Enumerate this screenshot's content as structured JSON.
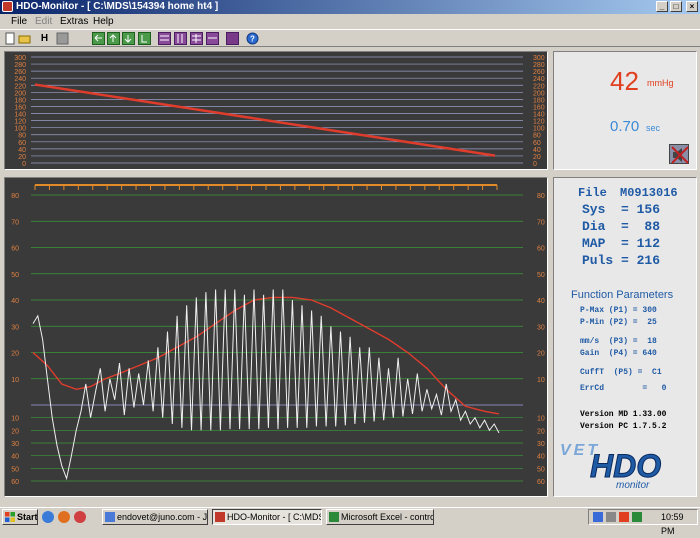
{
  "window": {
    "title": "HDO-Monitor - [ C:\\MDS\\154394 home ht4 ]",
    "controls": [
      "_",
      "□",
      "×"
    ]
  },
  "menu": {
    "file": "File",
    "edit": "Edit",
    "extras": "Extras",
    "help": "Help"
  },
  "toolbar": {
    "h_label": "H"
  },
  "readout": {
    "pressure_value": "42",
    "pressure_unit": "mmHg",
    "time_value": "0.70",
    "time_unit": "sec"
  },
  "info": {
    "file_label": "File",
    "file_value": "M0913016",
    "sys": "Sys  = 156",
    "dia": "Dia  =  88",
    "map": "MAP  = 112",
    "puls": "Puls = 216",
    "func_title": "Function Parameters",
    "params": [
      "P-Max (P1) = 300",
      "P-Min (P2) =  25",
      "mm/s  (P3) =  18",
      "Gain  (P4) = 640",
      "CuffT  (P5) =  C1",
      "ErrCd        =   0"
    ],
    "version_md": "Version MD 1.33.00",
    "version_pc": "Version PC 1.7.5.2",
    "logo_vet": "VET",
    "logo_hdo": "HDO",
    "logo_monitor": "monitor"
  },
  "top_chart": {
    "y_ticks": [
      "300",
      "280",
      "260",
      "240",
      "220",
      "200",
      "180",
      "160",
      "140",
      "120",
      "100",
      "80",
      "60",
      "40",
      "20",
      "0"
    ]
  },
  "main_chart": {
    "y_ticks_pos": [
      "80",
      "70",
      "60",
      "50",
      "40",
      "30",
      "20",
      "10"
    ],
    "y_ticks_neg": [
      "10",
      "20",
      "30",
      "40",
      "50",
      "60"
    ]
  },
  "chart_data": [
    {
      "type": "line",
      "series": [
        {
          "values": [
            [
              0,
              222
            ],
            [
              50,
              21
            ]
          ]
        }
      ],
      "ylim": [
        0,
        300
      ],
      "xlabel": "",
      "ylabel": ""
    },
    {
      "type": "line",
      "ylim": [
        -60,
        80
      ],
      "series": [
        {
          "values": [
            [
              0,
              20
            ],
            [
              3,
              15
            ],
            [
              6,
              8
            ],
            [
              9,
              6
            ],
            [
              12,
              7
            ],
            [
              15,
              10
            ],
            [
              18,
              12
            ],
            [
              22,
              15
            ],
            [
              26,
              18
            ],
            [
              30,
              22
            ],
            [
              34,
              26
            ],
            [
              38,
              31
            ],
            [
              42,
              36
            ],
            [
              46,
              40
            ],
            [
              50,
              41
            ],
            [
              54,
              41
            ],
            [
              58,
              40
            ],
            [
              62,
              37
            ],
            [
              66,
              33
            ],
            [
              70,
              29
            ],
            [
              74,
              25
            ],
            [
              78,
              20
            ],
            [
              82,
              14
            ],
            [
              86,
              6
            ],
            [
              90,
              -1
            ],
            [
              94,
              -5
            ],
            [
              97,
              -7
            ]
          ]
        },
        {
          "values": [
            [
              0,
              31
            ],
            [
              1,
              34
            ],
            [
              2,
              25
            ],
            [
              3,
              10
            ],
            [
              4,
              -10
            ],
            [
              5,
              -32
            ],
            [
              6,
              -48
            ],
            [
              7,
              -58
            ],
            [
              8,
              -40
            ],
            [
              9,
              -20
            ],
            [
              10,
              -5
            ],
            [
              11,
              8
            ],
            [
              12,
              -10
            ],
            [
              13,
              5
            ],
            [
              14,
              14
            ],
            [
              15,
              -5
            ],
            [
              16,
              10
            ],
            [
              17,
              2
            ],
            [
              18,
              16
            ],
            [
              19,
              -8
            ],
            [
              20,
              14
            ],
            [
              21,
              -2
            ],
            [
              22,
              12
            ],
            [
              23,
              0
            ],
            [
              24,
              17
            ],
            [
              25,
              -5
            ],
            [
              26,
              22
            ],
            [
              27,
              -10
            ],
            [
              28,
              28
            ],
            [
              29,
              -15
            ],
            [
              30,
              34
            ],
            [
              31,
              -18
            ],
            [
              32,
              38
            ],
            [
              33,
              -20
            ],
            [
              34,
              41
            ],
            [
              35,
              -20
            ],
            [
              36,
              43
            ],
            [
              37,
              -20
            ],
            [
              38,
              44
            ],
            [
              39,
              -20
            ],
            [
              40,
              44
            ],
            [
              41,
              -19
            ],
            [
              42,
              44
            ],
            [
              43,
              -19
            ],
            [
              44,
              42
            ],
            [
              45,
              -19
            ],
            [
              46,
              44
            ],
            [
              47,
              -19
            ],
            [
              48,
              42
            ],
            [
              49,
              -18
            ],
            [
              50,
              44
            ],
            [
              51,
              -19
            ],
            [
              52,
              44
            ],
            [
              53,
              -18
            ],
            [
              54,
              40
            ],
            [
              55,
              -18
            ],
            [
              56,
              38
            ],
            [
              57,
              -18
            ],
            [
              58,
              36
            ],
            [
              59,
              -17
            ],
            [
              60,
              34
            ],
            [
              61,
              -17
            ],
            [
              62,
              30
            ],
            [
              63,
              -17
            ],
            [
              64,
              28
            ],
            [
              65,
              -16
            ],
            [
              66,
              26
            ],
            [
              67,
              -15
            ],
            [
              68,
              22
            ],
            [
              69,
              -14
            ],
            [
              70,
              22
            ],
            [
              71,
              -13
            ],
            [
              72,
              18
            ],
            [
              73,
              -12
            ],
            [
              74,
              14
            ],
            [
              75,
              -10
            ],
            [
              76,
              18
            ],
            [
              77,
              -9
            ],
            [
              78,
              10
            ],
            [
              79,
              -7
            ],
            [
              80,
              12
            ],
            [
              81,
              -5
            ],
            [
              82,
              6
            ],
            [
              83,
              -3
            ],
            [
              84,
              4
            ],
            [
              85,
              -8
            ],
            [
              86,
              8
            ],
            [
              87,
              -5
            ],
            [
              88,
              2
            ],
            [
              89,
              -12
            ],
            [
              90,
              -5
            ],
            [
              91,
              -15
            ],
            [
              92,
              -10
            ],
            [
              93,
              -18
            ],
            [
              94,
              -12
            ],
            [
              95,
              -20
            ],
            [
              96,
              -15
            ],
            [
              97,
              -22
            ]
          ]
        }
      ]
    }
  ]
}
